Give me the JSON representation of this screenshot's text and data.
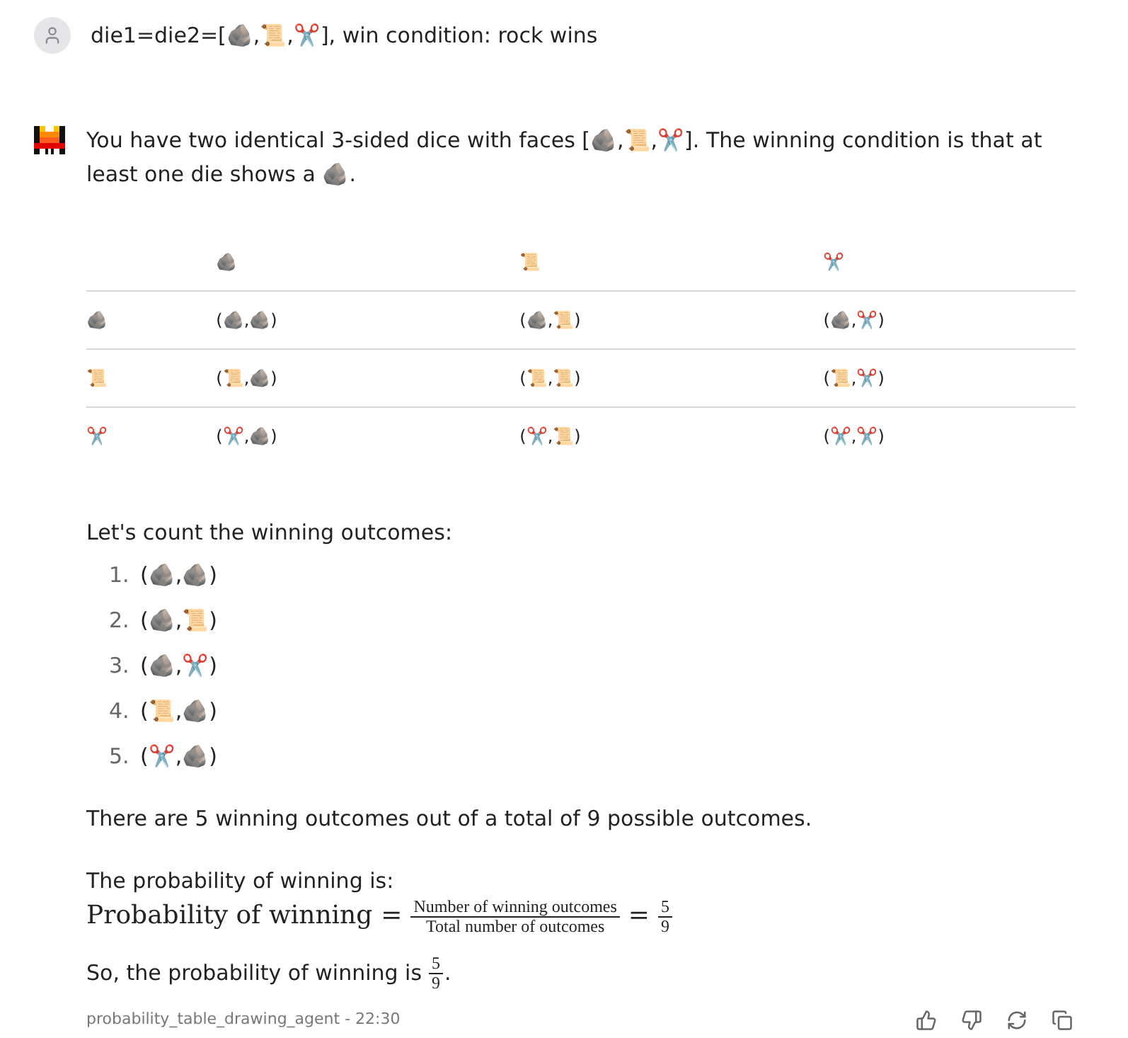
{
  "user_message": {
    "text": "die1=die2=[🪨,📜,✂️], win condition: rock wins"
  },
  "assistant": {
    "intro": "You have two identical 3-sided dice with faces [🪨,📜,✂️]. The winning condition is that at least one die shows a 🪨.",
    "table": {
      "columns": [
        "🪨",
        "📜",
        "✂️"
      ],
      "rows": [
        {
          "header": "🪨",
          "cells": [
            "(🪨,🪨)",
            "(🪨,📜)",
            "(🪨,✂️)"
          ]
        },
        {
          "header": "📜",
          "cells": [
            "(📜,🪨)",
            "(📜,📜)",
            "(📜,✂️)"
          ]
        },
        {
          "header": "✂️",
          "cells": [
            "(✂️,🪨)",
            "(✂️,📜)",
            "(✂️,✂️)"
          ]
        }
      ]
    },
    "count_heading": "Let's count the winning outcomes:",
    "outcomes": [
      {
        "number": "1.",
        "text": "(🪨,🪨)"
      },
      {
        "number": "2.",
        "text": "(🪨,📜)"
      },
      {
        "number": "3.",
        "text": "(🪨,✂️)"
      },
      {
        "number": "4.",
        "text": "(📜,🪨)"
      },
      {
        "number": "5.",
        "text": "(✂️,🪨)"
      }
    ],
    "summary": "There are 5 winning outcomes out of a total of 9 possible outcomes.",
    "probability_intro": "The probability of winning is:",
    "formula": {
      "lhs": "Probability of winning",
      "equals_1": "=",
      "numerator": "Number of winning outcomes",
      "denominator": "Total number of outcomes",
      "equals_2": "=",
      "result_numerator": "5",
      "result_denominator": "9"
    },
    "conclusion": {
      "prefix": "So, the probability of winning is",
      "numerator": "5",
      "denominator": "9",
      "suffix": "."
    },
    "footer": {
      "meta": "probability_table_drawing_agent - 22:30"
    }
  }
}
